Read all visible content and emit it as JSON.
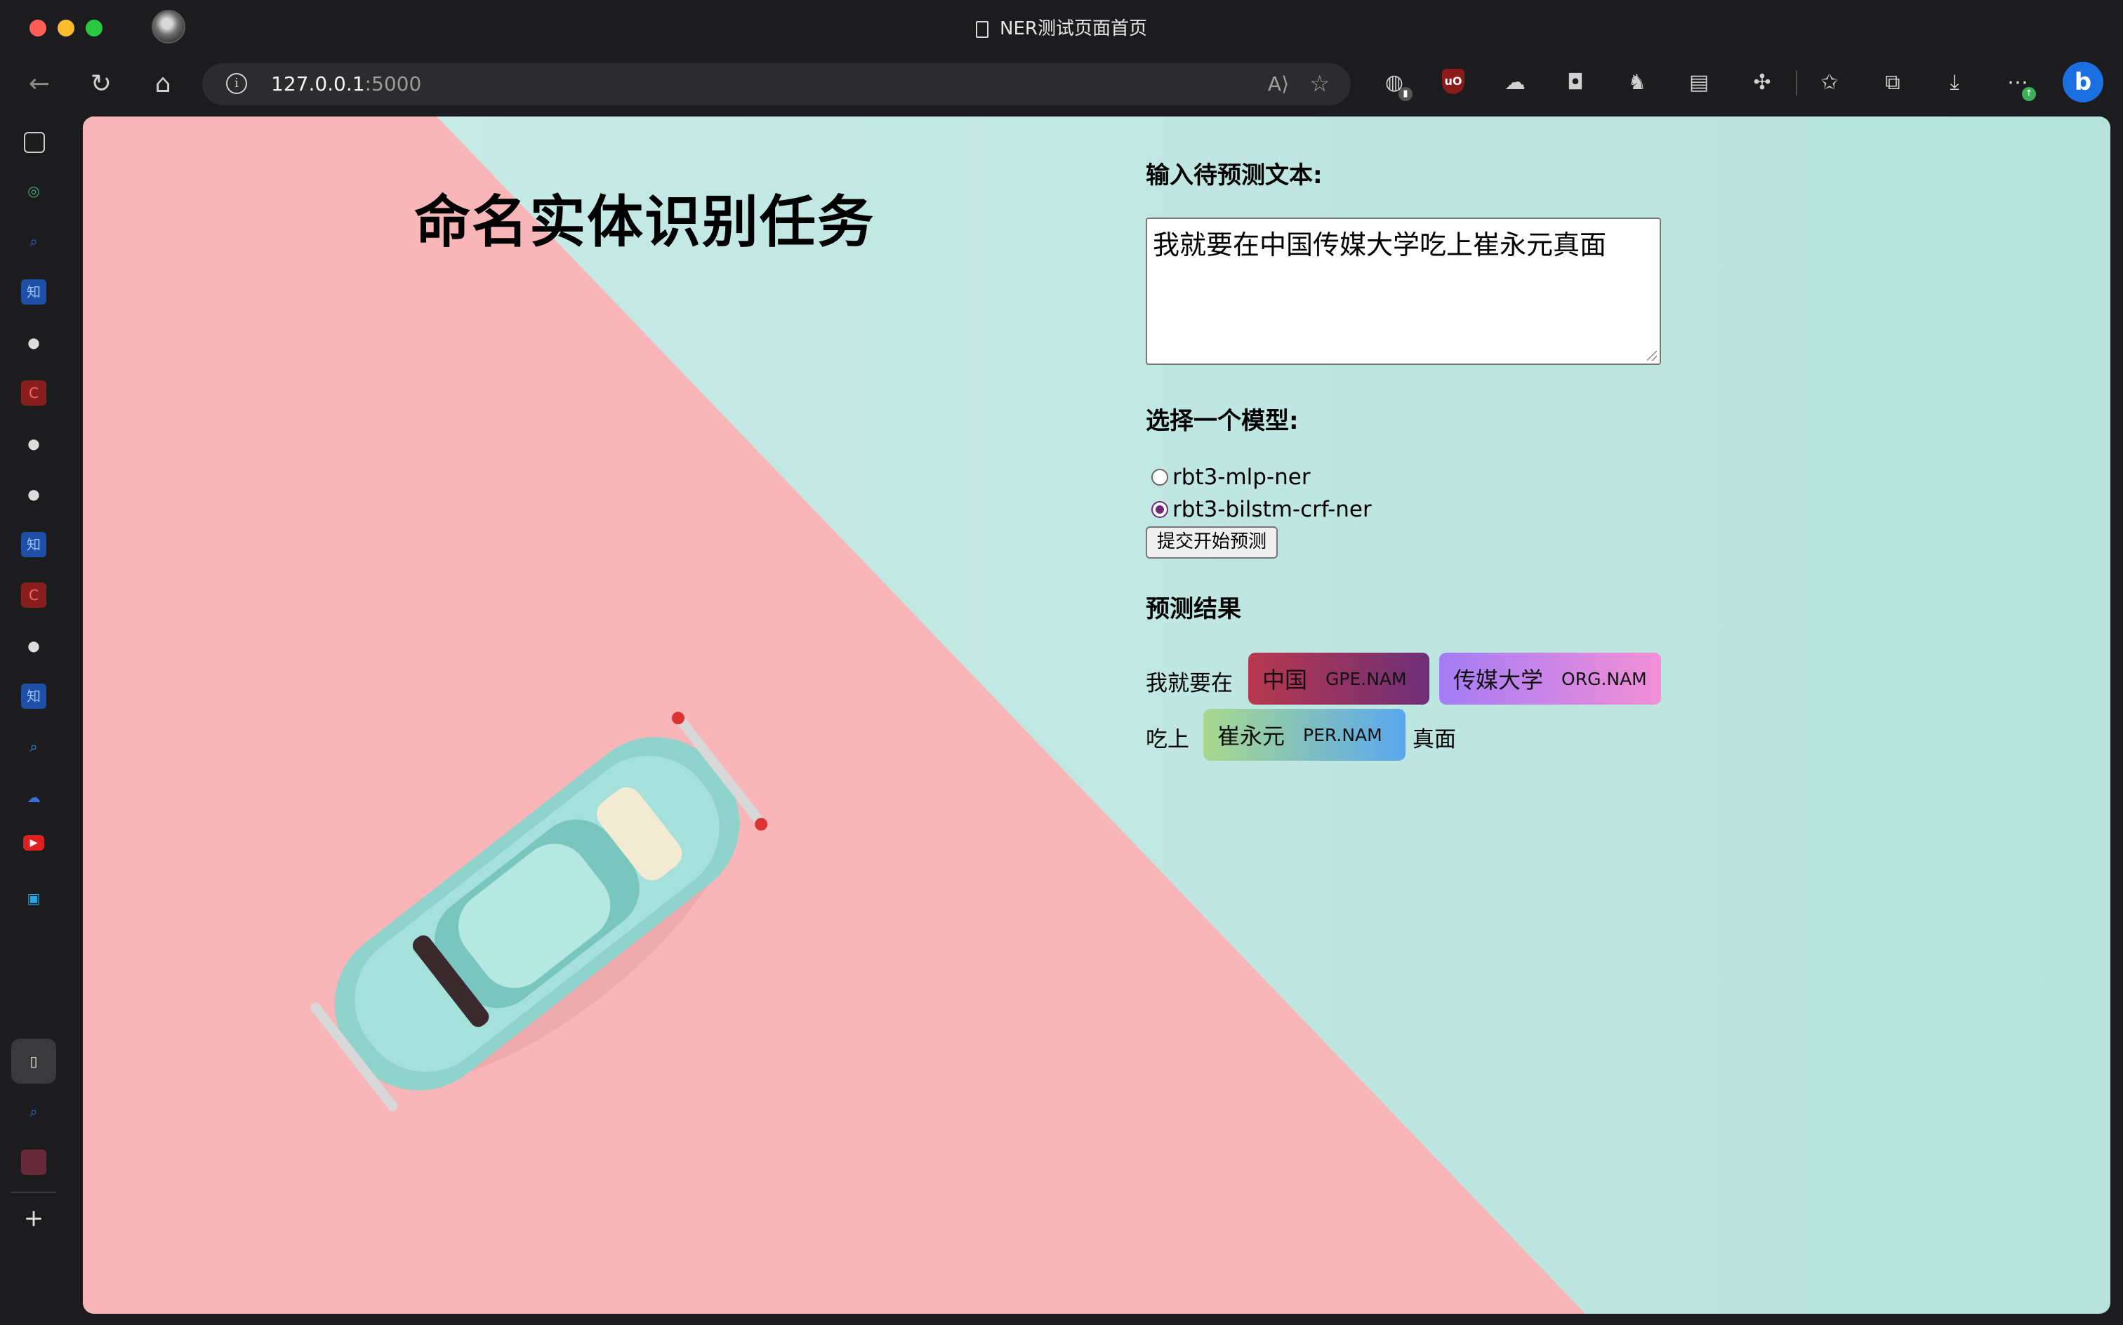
{
  "window": {
    "tab_title": "NER测试页面首页"
  },
  "address_bar": {
    "url_host": "127.0.0.1",
    "url_port": ":5000"
  },
  "page": {
    "heading": "命名实体识别任务",
    "input_label": "输入待预测文本:",
    "input_value": "我就要在中国传媒大学吃上崔永元真面",
    "model_label": "选择一个模型:",
    "models": [
      {
        "label": "rbt3-mlp-ner",
        "checked": false
      },
      {
        "label": "rbt3-bilstm-crf-ner",
        "checked": true
      }
    ],
    "submit_label": "提交开始预测",
    "result_heading": "预测结果",
    "result": {
      "text_1": "我就要在",
      "entity_1": {
        "word": "中国",
        "tag": "GPE.NAM"
      },
      "entity_2": {
        "word": "传媒大学",
        "tag": "ORG.NAM"
      },
      "text_2": "吃上",
      "entity_3": {
        "word": "崔永元",
        "tag": "PER.NAM"
      },
      "text_3": "真面"
    }
  },
  "colors": {
    "background_pink": "#f8b6b8",
    "background_mint": "#c4e9e3",
    "radio_accent": "#6f2a78",
    "chrome_dark": "#1c1c1e"
  }
}
